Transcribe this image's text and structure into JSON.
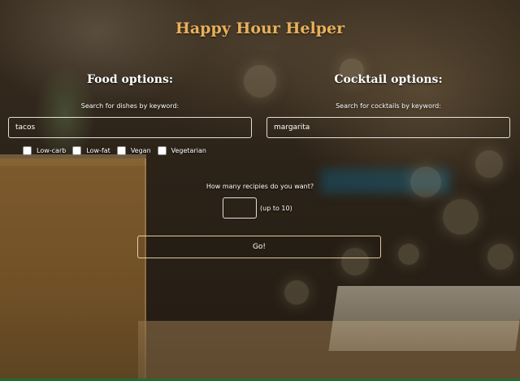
{
  "app": {
    "title": "Happy Hour Helper"
  },
  "food": {
    "heading": "Food options:",
    "search_label": "Search for dishes by keyword:",
    "search_value": "tacos",
    "filters": [
      {
        "label": "Low-carb",
        "checked": false
      },
      {
        "label": "Low-fat",
        "checked": false
      },
      {
        "label": "Vegan",
        "checked": false
      },
      {
        "label": "Vegetarian",
        "checked": false
      }
    ]
  },
  "cocktail": {
    "heading": "Cocktail options:",
    "search_label": "Search for cocktails by keyword:",
    "search_value": "margarita"
  },
  "recipes": {
    "question": "How many recipies do you want?",
    "count_value": "",
    "hint": "(up to 10)"
  },
  "actions": {
    "go_label": "Go!"
  },
  "colors": {
    "title": "#e8b15a",
    "text": "#ffffff",
    "border": "#ffffff"
  }
}
